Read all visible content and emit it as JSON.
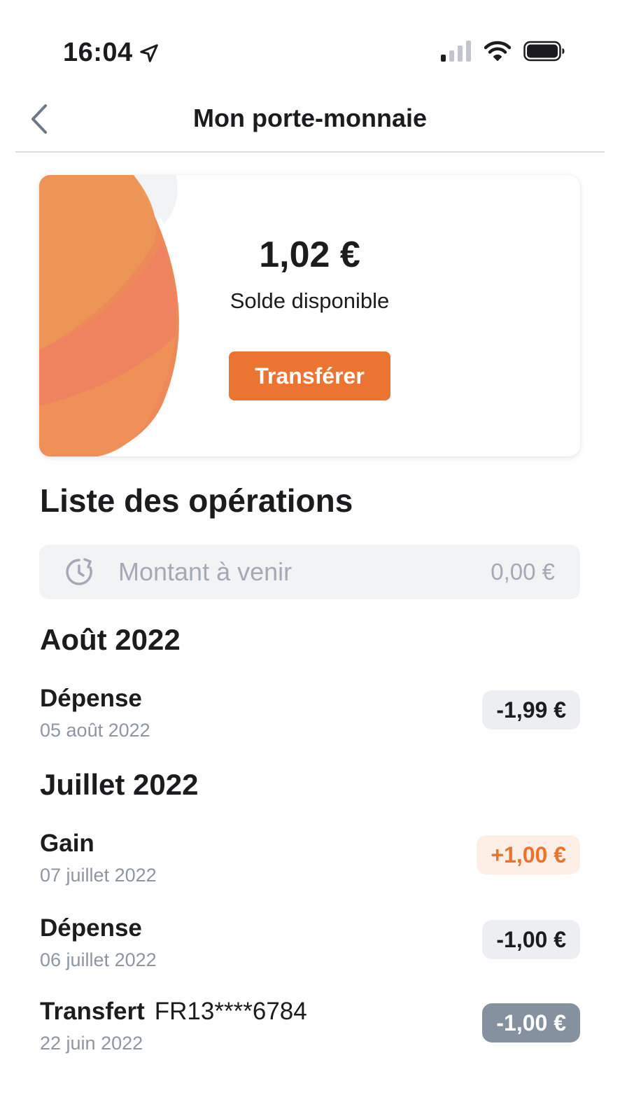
{
  "status_bar": {
    "time": "16:04",
    "icons": [
      "location-arrow-icon",
      "cellular-signal-icon",
      "wifi-icon",
      "battery-icon"
    ]
  },
  "nav": {
    "title": "Mon porte-monnaie",
    "back_icon": "chevron-left-icon"
  },
  "wallet": {
    "balance": "1,02 €",
    "balance_label": "Solde disponible",
    "transfer_label": "Transférer",
    "accent_color": "#ec7432"
  },
  "operations": {
    "title": "Liste des opérations",
    "upcoming": {
      "icon": "clock-icon",
      "label": "Montant à venir",
      "amount": "0,00 €"
    },
    "months": [
      {
        "heading": "Août 2022",
        "items": [
          {
            "title": "Dépense",
            "iban": "",
            "date": "05 août 2022",
            "amount": "-1,99 €",
            "kind": "debit"
          }
        ]
      },
      {
        "heading": "Juillet 2022",
        "items": [
          {
            "title": "Gain",
            "iban": "",
            "date": "07 juillet 2022",
            "amount": "+1,00 €",
            "kind": "credit"
          },
          {
            "title": "Dépense",
            "iban": "",
            "date": "06 juillet 2022",
            "amount": "-1,00 €",
            "kind": "debit"
          },
          {
            "title": "Transfert",
            "iban": "FR13****6784",
            "date": "22 juin 2022",
            "amount": "-1,00 €",
            "kind": "transfer"
          }
        ]
      }
    ]
  }
}
